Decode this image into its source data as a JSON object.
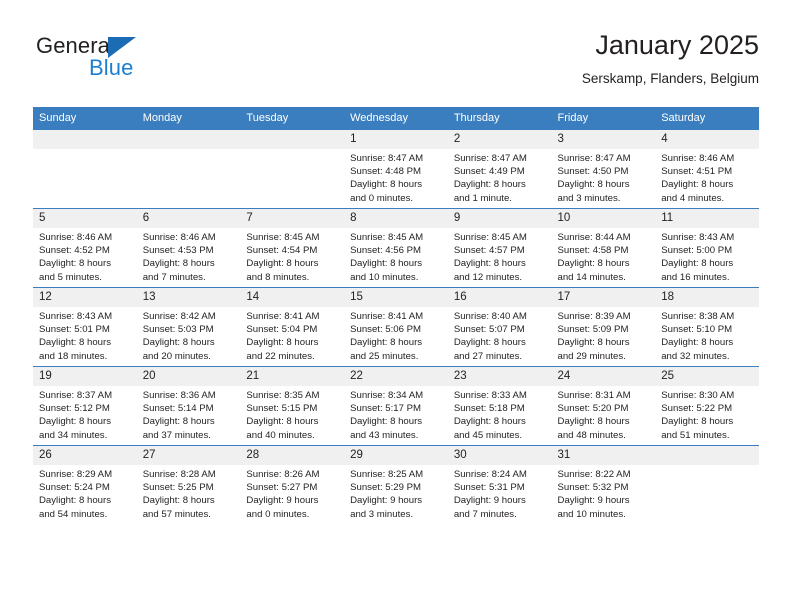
{
  "logo": {
    "word1": "General",
    "word2": "Blue",
    "triangle_color": "#1c6cb5",
    "word2_color": "#1c7fd0"
  },
  "header": {
    "title": "January 2025",
    "subtitle": "Serskamp, Flanders, Belgium"
  },
  "theme": {
    "header_bg": "#3a7ebf",
    "daynum_bg": "#f0f0f0",
    "text": "#231f20"
  },
  "calendar": {
    "weekday_headers": [
      "Sunday",
      "Monday",
      "Tuesday",
      "Wednesday",
      "Thursday",
      "Friday",
      "Saturday"
    ],
    "weeks": [
      [
        {
          "day": "",
          "lines": []
        },
        {
          "day": "",
          "lines": []
        },
        {
          "day": "",
          "lines": []
        },
        {
          "day": "1",
          "lines": [
            "Sunrise: 8:47 AM",
            "Sunset: 4:48 PM",
            "Daylight: 8 hours",
            "and 0 minutes."
          ]
        },
        {
          "day": "2",
          "lines": [
            "Sunrise: 8:47 AM",
            "Sunset: 4:49 PM",
            "Daylight: 8 hours",
            "and 1 minute."
          ]
        },
        {
          "day": "3",
          "lines": [
            "Sunrise: 8:47 AM",
            "Sunset: 4:50 PM",
            "Daylight: 8 hours",
            "and 3 minutes."
          ]
        },
        {
          "day": "4",
          "lines": [
            "Sunrise: 8:46 AM",
            "Sunset: 4:51 PM",
            "Daylight: 8 hours",
            "and 4 minutes."
          ]
        }
      ],
      [
        {
          "day": "5",
          "lines": [
            "Sunrise: 8:46 AM",
            "Sunset: 4:52 PM",
            "Daylight: 8 hours",
            "and 5 minutes."
          ]
        },
        {
          "day": "6",
          "lines": [
            "Sunrise: 8:46 AM",
            "Sunset: 4:53 PM",
            "Daylight: 8 hours",
            "and 7 minutes."
          ]
        },
        {
          "day": "7",
          "lines": [
            "Sunrise: 8:45 AM",
            "Sunset: 4:54 PM",
            "Daylight: 8 hours",
            "and 8 minutes."
          ]
        },
        {
          "day": "8",
          "lines": [
            "Sunrise: 8:45 AM",
            "Sunset: 4:56 PM",
            "Daylight: 8 hours",
            "and 10 minutes."
          ]
        },
        {
          "day": "9",
          "lines": [
            "Sunrise: 8:45 AM",
            "Sunset: 4:57 PM",
            "Daylight: 8 hours",
            "and 12 minutes."
          ]
        },
        {
          "day": "10",
          "lines": [
            "Sunrise: 8:44 AM",
            "Sunset: 4:58 PM",
            "Daylight: 8 hours",
            "and 14 minutes."
          ]
        },
        {
          "day": "11",
          "lines": [
            "Sunrise: 8:43 AM",
            "Sunset: 5:00 PM",
            "Daylight: 8 hours",
            "and 16 minutes."
          ]
        }
      ],
      [
        {
          "day": "12",
          "lines": [
            "Sunrise: 8:43 AM",
            "Sunset: 5:01 PM",
            "Daylight: 8 hours",
            "and 18 minutes."
          ]
        },
        {
          "day": "13",
          "lines": [
            "Sunrise: 8:42 AM",
            "Sunset: 5:03 PM",
            "Daylight: 8 hours",
            "and 20 minutes."
          ]
        },
        {
          "day": "14",
          "lines": [
            "Sunrise: 8:41 AM",
            "Sunset: 5:04 PM",
            "Daylight: 8 hours",
            "and 22 minutes."
          ]
        },
        {
          "day": "15",
          "lines": [
            "Sunrise: 8:41 AM",
            "Sunset: 5:06 PM",
            "Daylight: 8 hours",
            "and 25 minutes."
          ]
        },
        {
          "day": "16",
          "lines": [
            "Sunrise: 8:40 AM",
            "Sunset: 5:07 PM",
            "Daylight: 8 hours",
            "and 27 minutes."
          ]
        },
        {
          "day": "17",
          "lines": [
            "Sunrise: 8:39 AM",
            "Sunset: 5:09 PM",
            "Daylight: 8 hours",
            "and 29 minutes."
          ]
        },
        {
          "day": "18",
          "lines": [
            "Sunrise: 8:38 AM",
            "Sunset: 5:10 PM",
            "Daylight: 8 hours",
            "and 32 minutes."
          ]
        }
      ],
      [
        {
          "day": "19",
          "lines": [
            "Sunrise: 8:37 AM",
            "Sunset: 5:12 PM",
            "Daylight: 8 hours",
            "and 34 minutes."
          ]
        },
        {
          "day": "20",
          "lines": [
            "Sunrise: 8:36 AM",
            "Sunset: 5:14 PM",
            "Daylight: 8 hours",
            "and 37 minutes."
          ]
        },
        {
          "day": "21",
          "lines": [
            "Sunrise: 8:35 AM",
            "Sunset: 5:15 PM",
            "Daylight: 8 hours",
            "and 40 minutes."
          ]
        },
        {
          "day": "22",
          "lines": [
            "Sunrise: 8:34 AM",
            "Sunset: 5:17 PM",
            "Daylight: 8 hours",
            "and 43 minutes."
          ]
        },
        {
          "day": "23",
          "lines": [
            "Sunrise: 8:33 AM",
            "Sunset: 5:18 PM",
            "Daylight: 8 hours",
            "and 45 minutes."
          ]
        },
        {
          "day": "24",
          "lines": [
            "Sunrise: 8:31 AM",
            "Sunset: 5:20 PM",
            "Daylight: 8 hours",
            "and 48 minutes."
          ]
        },
        {
          "day": "25",
          "lines": [
            "Sunrise: 8:30 AM",
            "Sunset: 5:22 PM",
            "Daylight: 8 hours",
            "and 51 minutes."
          ]
        }
      ],
      [
        {
          "day": "26",
          "lines": [
            "Sunrise: 8:29 AM",
            "Sunset: 5:24 PM",
            "Daylight: 8 hours",
            "and 54 minutes."
          ]
        },
        {
          "day": "27",
          "lines": [
            "Sunrise: 8:28 AM",
            "Sunset: 5:25 PM",
            "Daylight: 8 hours",
            "and 57 minutes."
          ]
        },
        {
          "day": "28",
          "lines": [
            "Sunrise: 8:26 AM",
            "Sunset: 5:27 PM",
            "Daylight: 9 hours",
            "and 0 minutes."
          ]
        },
        {
          "day": "29",
          "lines": [
            "Sunrise: 8:25 AM",
            "Sunset: 5:29 PM",
            "Daylight: 9 hours",
            "and 3 minutes."
          ]
        },
        {
          "day": "30",
          "lines": [
            "Sunrise: 8:24 AM",
            "Sunset: 5:31 PM",
            "Daylight: 9 hours",
            "and 7 minutes."
          ]
        },
        {
          "day": "31",
          "lines": [
            "Sunrise: 8:22 AM",
            "Sunset: 5:32 PM",
            "Daylight: 9 hours",
            "and 10 minutes."
          ]
        },
        {
          "day": "",
          "lines": []
        }
      ]
    ]
  }
}
